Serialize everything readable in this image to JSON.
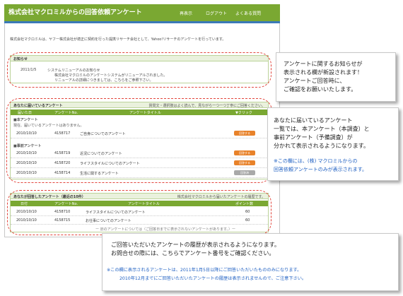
{
  "header": {
    "title": "株式会社マクロミルからの回答依頼アンケート",
    "nav": [
      "再表示",
      "ログアウト",
      "よくある質問"
    ]
  },
  "intro_text": "株式会社マクロミルは、ヤフー株式会社が適正に契約を行った提携リサーチ会社として、Yahoo!リサーチのアンケートを行っています。",
  "notice": {
    "title": "お知らせ",
    "date": "2011/1/5",
    "headline": "システムリニューアルのお知らせ",
    "lines": [
      "株式会社マクロミルのアンケートシステムがリニューアルされました。",
      "リニューアルの詳細につきましては、こちらをご参照下さい。"
    ]
  },
  "received": {
    "title": "あなたに届いているアンケート",
    "note": "質問文・選択肢はよく読んで、見ながら一つ一つ丁寧にご回答ください。",
    "columns": [
      "届いた日",
      "アンケートNo.",
      "アンケートタイトル",
      "▼クリック"
    ],
    "main_label": "■本アンケート",
    "main_empty": "現在、届いているアンケートはありません。",
    "pre_label": "■事前アンケート",
    "rows": [
      {
        "date": "2010/10/10",
        "no": "4158717",
        "title": "ご自身についてのアンケート",
        "btn": "回答する"
      },
      {
        "date": "2010/10/10",
        "no": "4158719",
        "title": "近況についてのアンケート",
        "btn": "回答する"
      },
      {
        "date": "2010/10/10",
        "no": "4158720",
        "title": "ライフスタイルについてのアンケート",
        "btn": "回答する"
      },
      {
        "date": "2010/10/10",
        "no": "4158714",
        "title": "生活に関するアンケート",
        "btn": "回答済"
      }
    ]
  },
  "history": {
    "title": "あなたが回答したアンケート（最近の10件）",
    "note": "株式会社マクロミルから届いたアンケートの履歴です。",
    "columns": [
      "日付",
      "アンケートNo.",
      "アンケートタイトル",
      "ポイント数"
    ],
    "rows": [
      {
        "date": "2010/10/10",
        "no": "4158710",
        "title": "ライフスタイルについてのアンケート",
        "points": "60"
      },
      {
        "date": "2010/10/10",
        "no": "4158715",
        "title": "お仕事についてのアンケート",
        "points": "60"
      }
    ],
    "footer": "ー 旧のアンケートについては（ご回答日までに表示されないアンケートがあります。）ー"
  },
  "callouts": {
    "c1": [
      "アンケートに関するお知らせが",
      "表示される欄が新設されます！",
      "アンケートご回答時に、",
      "ご確認をお願いいたします。"
    ],
    "c2": [
      "あなたに届いているアンケート",
      "一覧では、本アンケート（本調査）と",
      "事前アンケート（予備調査）が",
      "分かれて表示されるようになります。"
    ],
    "c2_note": [
      "※この欄には、(株) マクロミルからの",
      "回答依頼アンケートのみが表示されます。"
    ],
    "c3": [
      "ご回答いただいたアンケートの履歴が表示されるようになります。",
      "お問合せの際には、こちらでアンケート番号をご確認ください。"
    ],
    "c3_note": [
      "※この欄に表示されるアンケートは、2011年1月5日以降にご回答いただいたもののみになります。",
      "2010年12月までにご回答いただいたアンケートの履歴は表示されませんので、ご注意下さい。"
    ]
  },
  "colors": {
    "header_green": "#7aa832",
    "accent_blue": "#3b79b8",
    "highlight_red": "#e2453c",
    "note_blue": "#1e5fc2",
    "answer_orange": "#e8822a",
    "answered_gray": "#a9a9a9"
  }
}
